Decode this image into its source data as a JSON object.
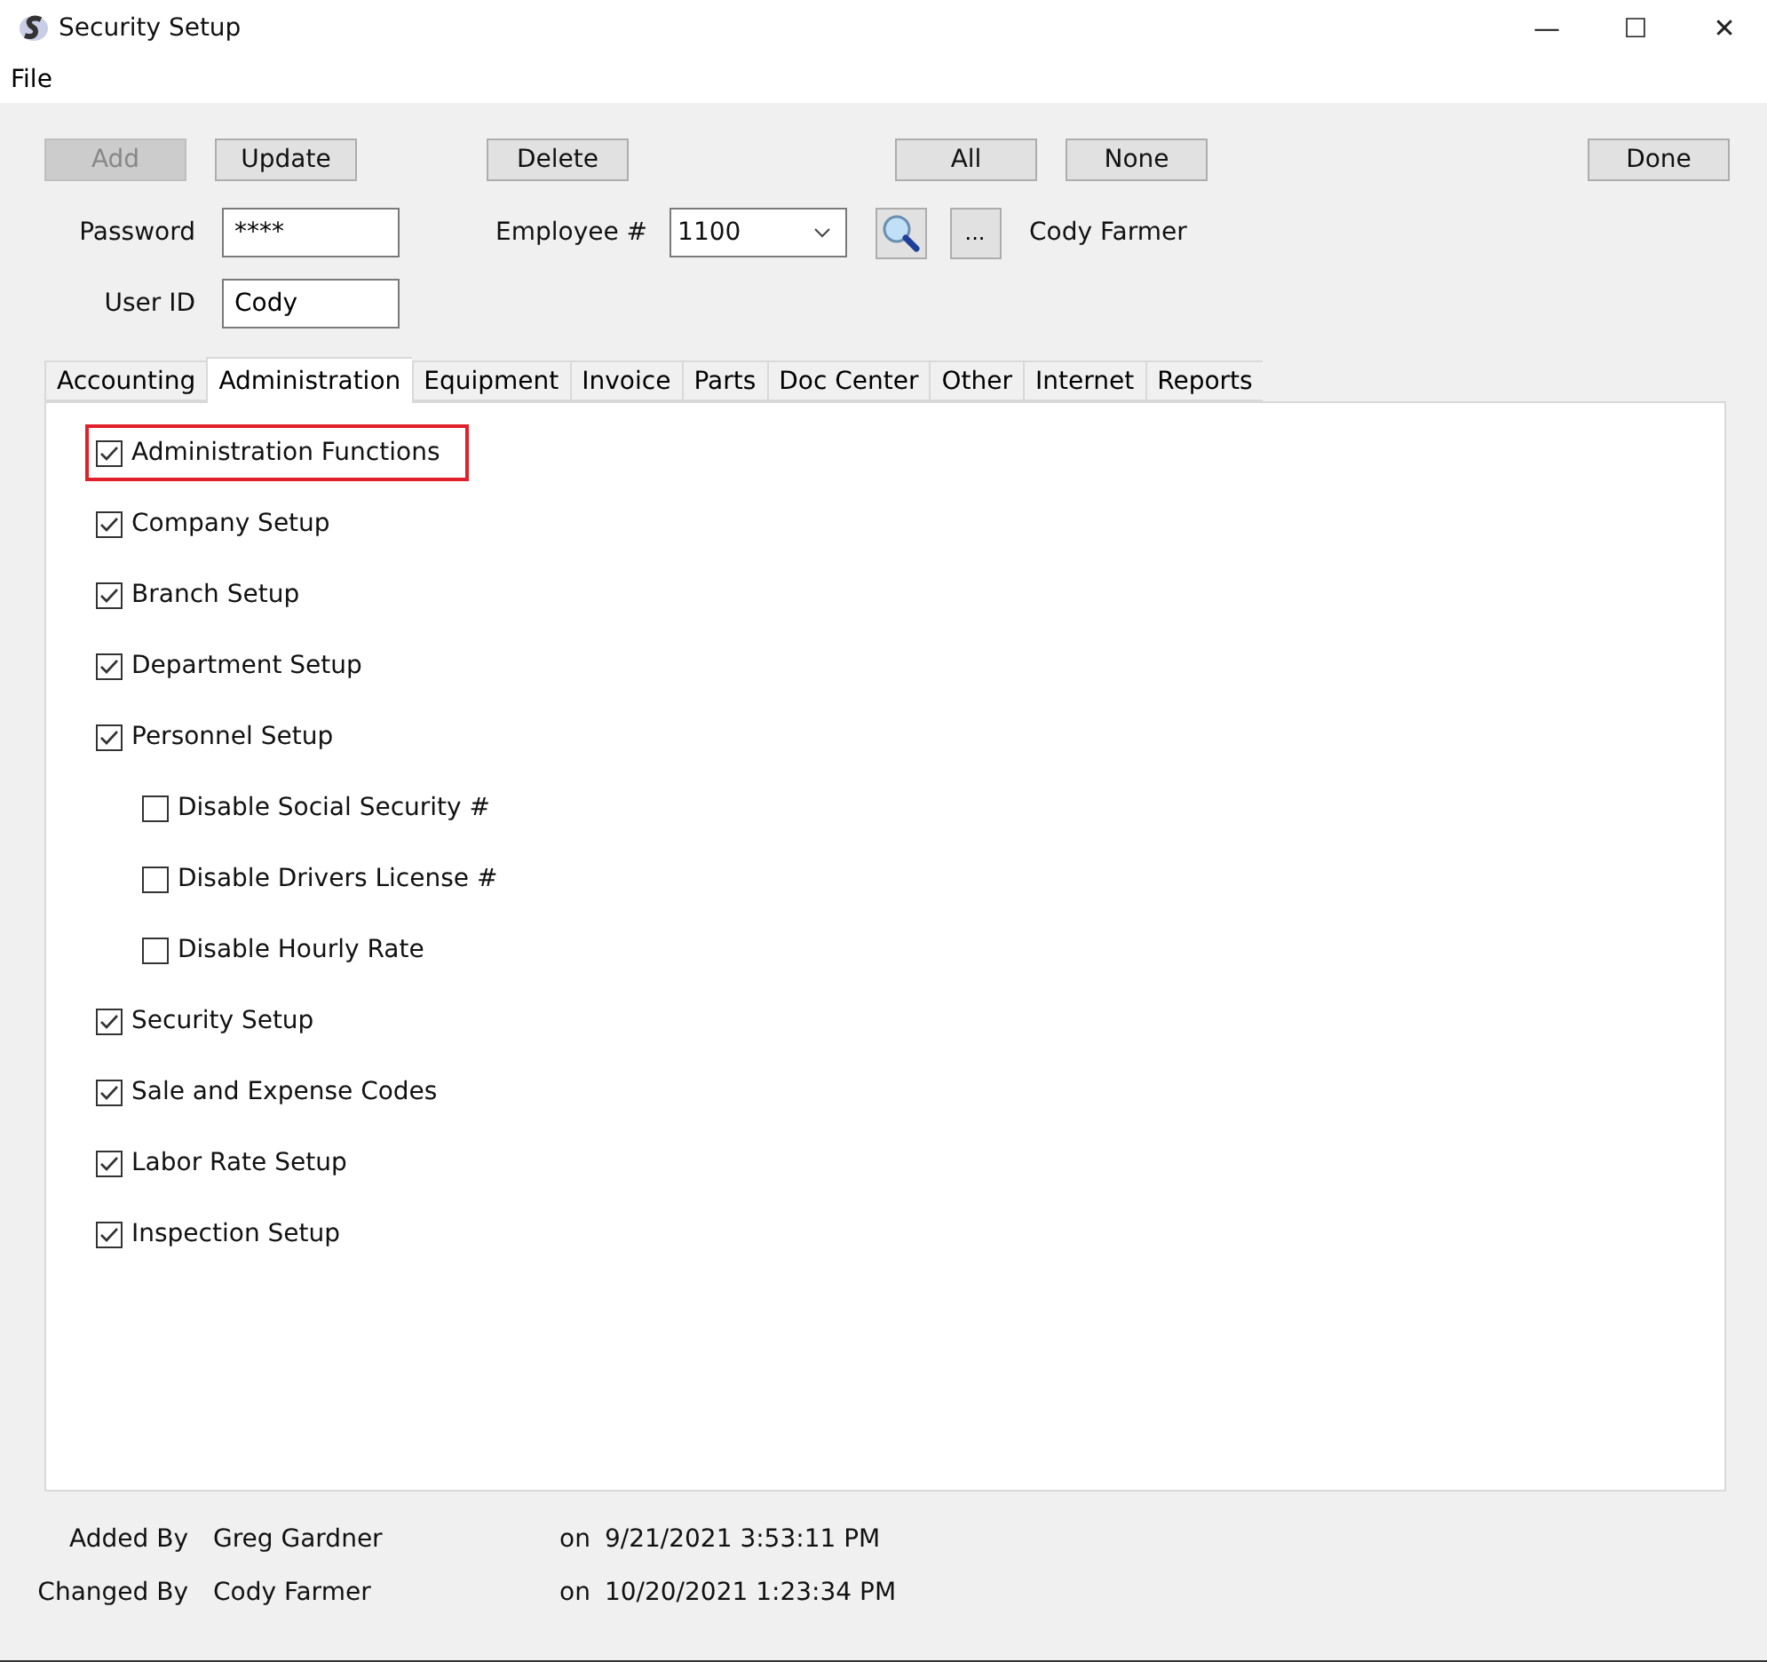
{
  "window": {
    "title": "Security Setup",
    "controls": [
      "—",
      "☐",
      "✕"
    ]
  },
  "menu": [
    "File"
  ],
  "buttons": [
    {
      "label": "Add",
      "disabled": true
    },
    {
      "label": "Update",
      "disabled": false
    },
    {
      "label": "Delete",
      "disabled": false
    },
    {
      "label": "All",
      "disabled": false
    },
    {
      "label": "None",
      "disabled": false
    },
    {
      "label": "Done",
      "disabled": false
    }
  ],
  "password": {
    "label": "Password",
    "value": "****"
  },
  "user_id": {
    "label": "User ID",
    "value": "Cody"
  },
  "employee": {
    "label": "Employee #",
    "value": "1100",
    "browse": "...",
    "name": "Cody Farmer"
  },
  "tabs": [
    {
      "label": "Accounting",
      "selected": false
    },
    {
      "label": "Administration",
      "selected": true
    },
    {
      "label": "Equipment",
      "selected": false
    },
    {
      "label": "Invoice",
      "selected": false
    },
    {
      "label": "Parts",
      "selected": false
    },
    {
      "label": "Doc Center",
      "selected": false
    },
    {
      "label": "Other",
      "selected": false
    },
    {
      "label": "Internet",
      "selected": false
    },
    {
      "label": "Reports",
      "selected": false
    }
  ],
  "permissions": [
    {
      "label": "Administration Functions",
      "checked": true,
      "highlighted": true
    },
    {
      "label": "Company Setup",
      "checked": true,
      "highlighted": false
    },
    {
      "label": "Branch Setup",
      "checked": true,
      "highlighted": false
    },
    {
      "label": "Department Setup",
      "checked": true,
      "highlighted": false
    },
    {
      "label": "Personnel Setup",
      "checked": true,
      "highlighted": false,
      "children": [
        {
          "label": "Disable Social Security #",
          "checked": false,
          "highlighted": false
        },
        {
          "label": "Disable Drivers License #",
          "checked": false,
          "highlighted": false
        },
        {
          "label": "Disable Hourly Rate",
          "checked": false,
          "highlighted": false
        }
      ]
    },
    {
      "label": "Security Setup",
      "checked": true,
      "highlighted": false
    },
    {
      "label": "Sale and Expense Codes",
      "checked": true,
      "highlighted": false
    },
    {
      "label": "Labor Rate Setup",
      "checked": true,
      "highlighted": false
    },
    {
      "label": "Inspection Setup",
      "checked": true,
      "highlighted": false
    }
  ],
  "audit": [
    {
      "label": "Added By",
      "name": "Greg Gardner",
      "on": "on",
      "date": "9/21/2021 3:53:11 PM"
    },
    {
      "label": "Changed By",
      "name": "Cody Farmer",
      "on": "on",
      "date": "10/20/2021 1:23:34 PM"
    }
  ]
}
